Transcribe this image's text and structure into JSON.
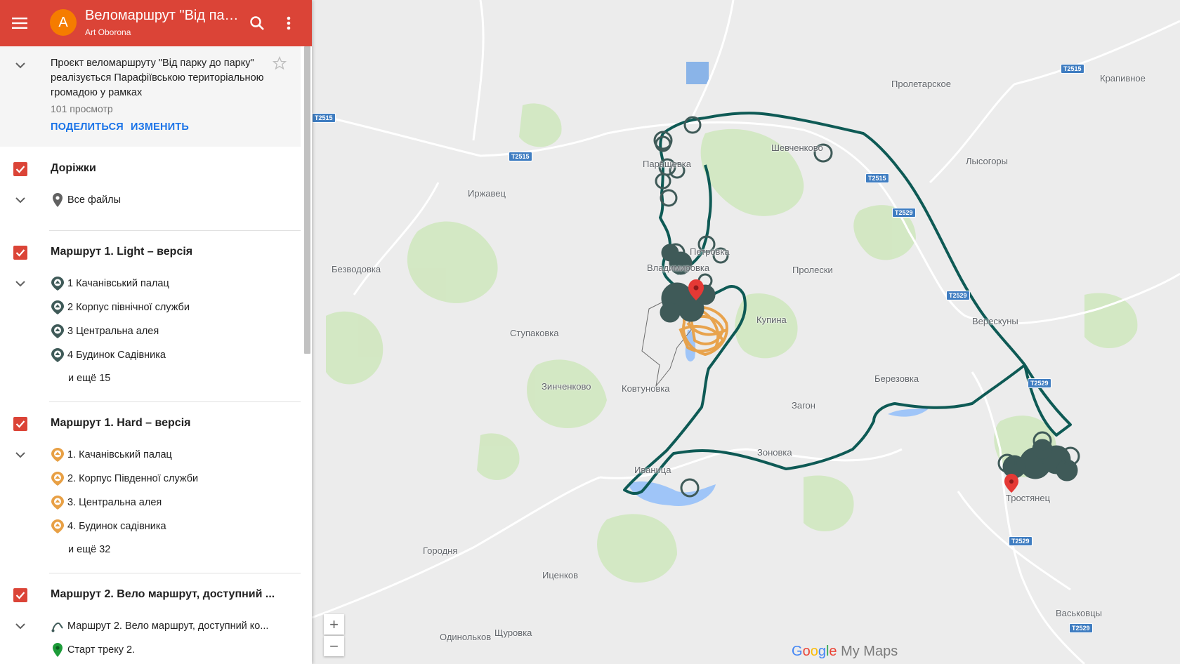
{
  "header": {
    "avatar_letter": "A",
    "title": "Веломаршрут \"Від парку до парку\"",
    "owner": "Art Oborona",
    "menu_icon": "menu-icon",
    "search_icon": "search-icon",
    "more_icon": "more-vert-icon"
  },
  "description": {
    "text": "Проєкт веломаршруту \"Від парку до парку\" реалізується Парафіївською територіальною громадою у рамках",
    "views": "101 просмотр",
    "share_label": "ПОДЕЛИТЬСЯ",
    "edit_label": "ИЗМЕНИТЬ"
  },
  "layers": [
    {
      "title": "Доріжки",
      "items": [
        {
          "label": "Все файлы",
          "icon": "pin-icon"
        }
      ],
      "more": ""
    },
    {
      "title": "Маршрут 1. Light – версія",
      "items": [
        {
          "label": "1 Качанівський палац",
          "icon": "park-marker-icon"
        },
        {
          "label": "2 Корпус північної служби",
          "icon": "park-marker-icon"
        },
        {
          "label": "3 Центральна алея",
          "icon": "park-marker-icon"
        },
        {
          "label": "4 Будинок Садівника",
          "icon": "park-marker-icon"
        }
      ],
      "more": "и ещё 15"
    },
    {
      "title": "Маршрут 1. Hard – версія",
      "items": [
        {
          "label": "1. Качанівський палац",
          "icon": "park-marker-icon"
        },
        {
          "label": "2. Корпус Південної служби",
          "icon": "park-marker-icon"
        },
        {
          "label": "3. Центральна алея",
          "icon": "park-marker-icon"
        },
        {
          "label": "4. Будинок садівника",
          "icon": "park-marker-icon"
        }
      ],
      "more": "и ещё 32"
    },
    {
      "title": "Маршрут 2. Вело маршрут, доступний ...",
      "items": [
        {
          "label": "Маршрут 2.  Вело маршрут, доступний ко...",
          "icon": "line-route-icon"
        },
        {
          "label": "Старт треку 2.",
          "icon": "green-pin-icon"
        }
      ],
      "more": ""
    }
  ],
  "colors": {
    "header": "#db4437",
    "route_line": "#0e5a55",
    "light_marker": "#3f5a58",
    "hard_marker": "#e8a045",
    "map_bg": "#ececec",
    "field_green": "#c7e3b5",
    "water": "#9fc5f8"
  },
  "map": {
    "places": [
      "Пролетарское",
      "Крапивное",
      "Шевченково",
      "Лысогоры",
      "Паращевка",
      "Иржавец",
      "Петровка",
      "Безводовка",
      "Пролески",
      "Владимировка",
      "Купина",
      "Ступаковка",
      "Верескуны",
      "Березовка",
      "Зинченково",
      "Ковтуновка",
      "Загон",
      "Зоновка",
      "Иваница",
      "Тростянец",
      "Городня",
      "Иценков",
      "Щуровка",
      "Одинольков",
      "Васьковцы"
    ],
    "road_labels": [
      "T2515",
      "T2515",
      "T2515",
      "T2515",
      "T2529",
      "T2529",
      "T2529",
      "T2529",
      "T2529"
    ],
    "zoom_in": "+",
    "zoom_out": "−",
    "logo_text": "My Maps"
  }
}
